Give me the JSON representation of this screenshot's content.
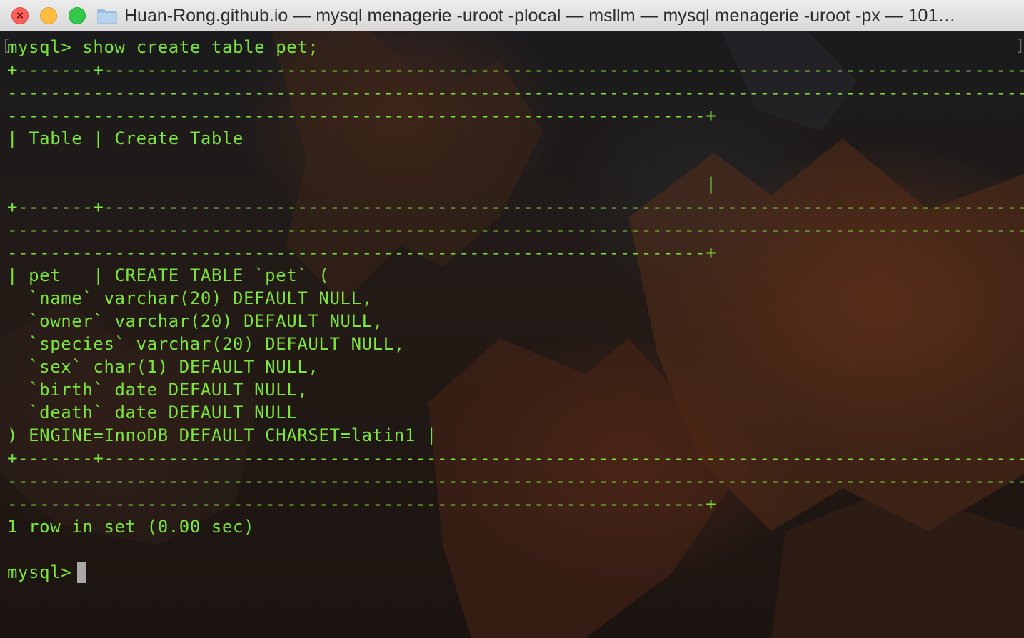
{
  "window": {
    "title": "Huan-Rong.github.io — mysql menagerie -uroot -plocal — msllm — mysql menagerie -uroot -px — 101…"
  },
  "icons": {
    "close": "close-icon",
    "minimize": "minimize-icon",
    "maximize": "maximize-icon",
    "folder": "folder-icon"
  },
  "colors": {
    "terminal_text": "#7de33d",
    "close": "#fc605c",
    "minimize": "#fdbc40",
    "maximize": "#34c84a"
  },
  "terminal": {
    "lines": [
      "mysql> show create table pet;",
      "+-------+------------------------------------------------------------------------------------------",
      "-------------------------------------------------------------------------------------------------",
      "-----------------------------------------------------------------+",
      "| Table | Create Table",
      "",
      "                                                                 |",
      "+-------+------------------------------------------------------------------------------------------",
      "-------------------------------------------------------------------------------------------------",
      "-----------------------------------------------------------------+",
      "| pet   | CREATE TABLE `pet` (",
      "  `name` varchar(20) DEFAULT NULL,",
      "  `owner` varchar(20) DEFAULT NULL,",
      "  `species` varchar(20) DEFAULT NULL,",
      "  `sex` char(1) DEFAULT NULL,",
      "  `birth` date DEFAULT NULL,",
      "  `death` date DEFAULT NULL",
      ") ENGINE=InnoDB DEFAULT CHARSET=latin1 |",
      "+-------+------------------------------------------------------------------------------------------",
      "-------------------------------------------------------------------------------------------------",
      "-----------------------------------------------------------------+",
      "1 row in set (0.00 sec)",
      "",
      "mysql> "
    ],
    "left_bracket": "[",
    "right_bracket": "]"
  }
}
